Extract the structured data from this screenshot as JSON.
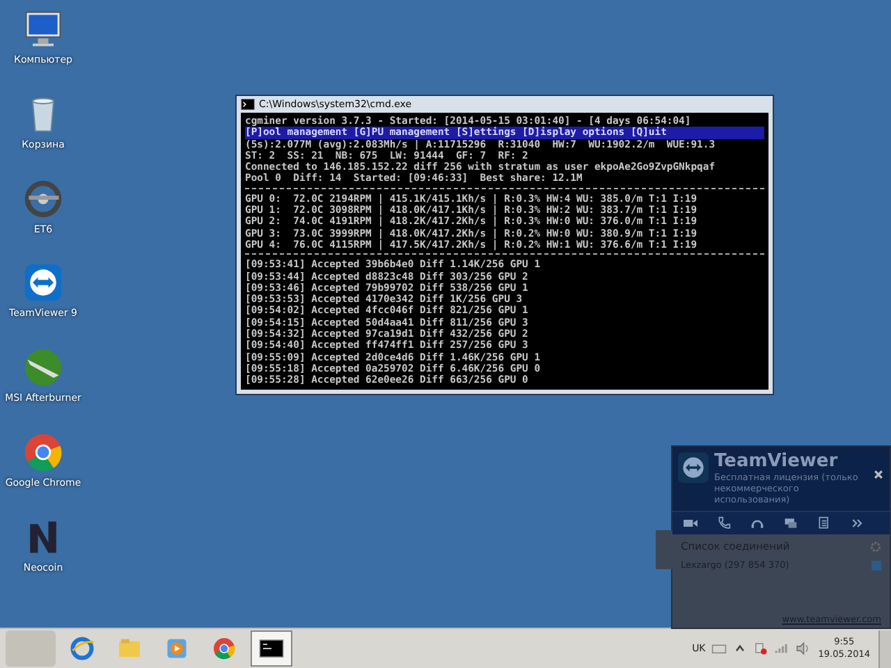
{
  "desktop_icons": [
    {
      "label": "Компьютер",
      "kind": "computer"
    },
    {
      "label": "Корзина",
      "kind": "bin"
    },
    {
      "label": "ET6",
      "kind": "wheel"
    },
    {
      "label": "TeamViewer 9",
      "kind": "teamviewer"
    },
    {
      "label": "MSI Afterburner",
      "kind": "afterburner"
    },
    {
      "label": "Google Chrome",
      "kind": "chrome"
    },
    {
      "label": "Neocoin",
      "kind": "neocoin"
    }
  ],
  "cmd_window": {
    "title": "C:\\Windows\\system32\\cmd.exe",
    "header_line": "cgminer version 3.7.3 - Started: [2014-05-15 03:01:40] - [4 days 06:54:04]",
    "menu_line": "[P]ool management [G]PU management [S]ettings [D]isplay options [Q]uit",
    "status_lines": [
      "(5s):2.077M (avg):2.083Mh/s | A:11715296  R:31040  HW:7  WU:1902.2/m  WUE:91.3",
      "ST: 2  SS: 21  NB: 675  LW: 91444  GF: 7  RF: 2",
      "Connected to 146.185.152.22 diff 256 with stratum as user ekpoAe2Go9ZvpGNkpqaf",
      "Pool 0  Diff: 14  Started: [09:46:33]  Best share: 12.1M"
    ],
    "gpu_lines": [
      "GPU 0:  72.0C 2194RPM | 415.1K/415.1Kh/s | R:0.3% HW:4 WU: 385.0/m T:1 I:19",
      "GPU 1:  72.0C 3098RPM | 418.0K/417.1Kh/s | R:0.3% HW:2 WU: 383.7/m T:1 I:19",
      "GPU 2:  74.0C 4191RPM | 418.2K/417.2Kh/s | R:0.3% HW:0 WU: 376.0/m T:1 I:19",
      "GPU 3:  73.0C 3999RPM | 418.0K/417.2Kh/s | R:0.2% HW:0 WU: 380.9/m T:1 I:19",
      "GPU 4:  76.0C 4115RPM | 417.5K/417.2Kh/s | R:0.2% HW:1 WU: 376.6/m T:1 I:19"
    ],
    "log_lines": [
      "[09:53:41] Accepted 39b6b4e0 Diff 1.14K/256 GPU 1",
      "[09:53:44] Accepted d8823c48 Diff 303/256 GPU 2",
      "[09:53:46] Accepted 79b99702 Diff 538/256 GPU 1",
      "[09:53:53] Accepted 4170e342 Diff 1K/256 GPU 3",
      "[09:54:02] Accepted 4fcc046f Diff 821/256 GPU 1",
      "[09:54:15] Accepted 50d4aa41 Diff 811/256 GPU 3",
      "[09:54:32] Accepted 97ca19d1 Diff 432/256 GPU 2",
      "[09:54:40] Accepted ff474ff1 Diff 257/256 GPU 3",
      "[09:55:09] Accepted 2d0ce4d6 Diff 1.46K/256 GPU 1",
      "[09:55:18] Accepted 0a259702 Diff 6.46K/256 GPU 0",
      "[09:55:28] Accepted 62e0ee26 Diff 663/256 GPU 0"
    ]
  },
  "teamviewer": {
    "title": "TeamViewer",
    "subtitle": "Бесплатная лицензия (только некоммерческого использования)",
    "section_title": "Список соединений",
    "contact": "Lexzargo (297 854 370)",
    "link": "www.teamviewer.com"
  },
  "taskbar": {
    "apps": [
      {
        "kind": "ie",
        "selected": false
      },
      {
        "kind": "folder",
        "selected": false
      },
      {
        "kind": "media",
        "selected": false
      },
      {
        "kind": "chrome",
        "selected": false
      },
      {
        "kind": "console",
        "selected": true
      }
    ],
    "language": "UK",
    "time": "9:55",
    "date": "19.05.2014"
  }
}
